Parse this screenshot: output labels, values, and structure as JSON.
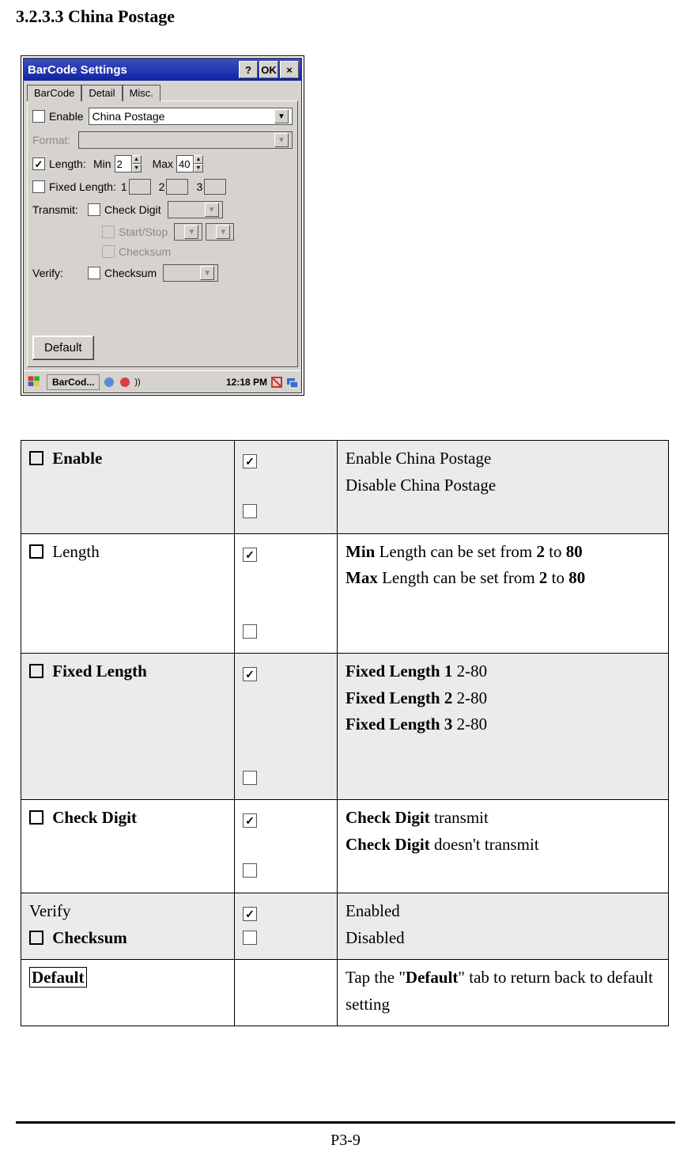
{
  "heading": "3.2.3.3 China Postage",
  "window": {
    "title": "BarCode Settings",
    "btn_help": "?",
    "btn_ok": "OK",
    "btn_close": "×",
    "tabs": {
      "barcode": "BarCode",
      "detail": "Detail",
      "misc": "Misc."
    },
    "fields": {
      "enable_label": "Enable",
      "symbology": "China Postage",
      "format_label": "Format:",
      "length_label": "Length:",
      "min_label": "Min",
      "min_value": "2",
      "max_label": "Max",
      "max_value": "40",
      "fixed_label": "Fixed Length:",
      "fl1": "1",
      "fl2": "2",
      "fl3": "3",
      "transmit_label": "Transmit:",
      "check_digit_label": "Check Digit",
      "startstop_label": "Start/Stop",
      "checksum_t_label": "Checksum",
      "verify_label": "Verify:",
      "checksum_v_label": "Checksum",
      "default_btn": "Default"
    },
    "taskbar": {
      "app": "BarCod...",
      "time": "12:18 PM"
    }
  },
  "table": {
    "r1": {
      "label": "Enable",
      "desc_on": "Enable China Postage",
      "desc_off": "Disable China Postage"
    },
    "r2": {
      "label": "Length",
      "min_pre": "Min",
      "min_rest": " Length can be set from ",
      "min_a": "2",
      "min_to": " to ",
      "min_b": "80",
      "max_pre": "Max",
      "max_rest": " Length can be set from ",
      "max_a": "2",
      "max_to": " to ",
      "max_b": "80"
    },
    "r3": {
      "label": "Fixed Length",
      "fl1_pre": "Fixed Length 1",
      "fl1_rest": " 2-80",
      "fl2_pre": "Fixed Length 2",
      "fl2_rest": " 2-80",
      "fl3_pre": "Fixed Length 3",
      "fl3_rest": " 2-80"
    },
    "r4": {
      "label": "Check Digit",
      "on_pre": "Check Digit",
      "on_rest": " transmit",
      "off_pre": "Check Digit",
      "off_rest": " doesn't transmit"
    },
    "r5": {
      "pre": "Verify",
      "label": "Checksum",
      "on": "Enabled",
      "off": "Disabled"
    },
    "r6": {
      "label": "Default",
      "desc_a": "Tap the \"",
      "desc_b": "Default",
      "desc_c": "\" tab to return back to default setting"
    }
  },
  "page_number": "P3-9"
}
